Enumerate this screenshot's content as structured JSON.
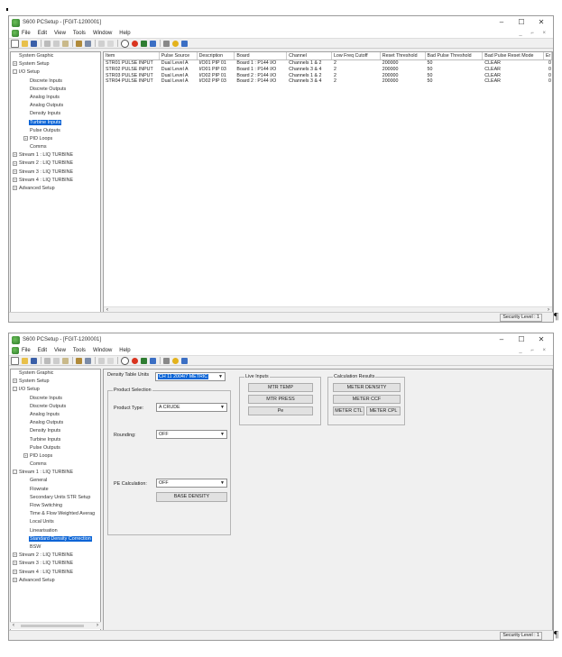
{
  "window1": {
    "title": "S600 PCSetup - [FGIT-1200001]",
    "menu": [
      "File",
      "Edit",
      "View",
      "Tools",
      "Window",
      "Help"
    ],
    "mdi_controls": "_ ⌐ ×",
    "tree": [
      {
        "label": "System Graphic",
        "level": 0,
        "expander": ""
      },
      {
        "label": "System Setup",
        "level": 0,
        "expander": "+"
      },
      {
        "label": "I/O Setup",
        "level": 0,
        "expander": "-"
      },
      {
        "label": "Discrete Inputs",
        "level": 1,
        "expander": ""
      },
      {
        "label": "Discrete Outputs",
        "level": 1,
        "expander": ""
      },
      {
        "label": "Analog Inputs",
        "level": 1,
        "expander": ""
      },
      {
        "label": "Analog Outputs",
        "level": 1,
        "expander": ""
      },
      {
        "label": "Density Inputs",
        "level": 1,
        "expander": ""
      },
      {
        "label": "Turbine Inputs",
        "level": 1,
        "expander": "",
        "selected": true
      },
      {
        "label": "Pulse Outputs",
        "level": 1,
        "expander": ""
      },
      {
        "label": "PID Loops",
        "level": 1,
        "expander": "+"
      },
      {
        "label": "Comms",
        "level": 1,
        "expander": ""
      },
      {
        "label": "Stream 1 : LIQ TURBINE",
        "level": 0,
        "expander": "+"
      },
      {
        "label": "Stream 2 : LIQ TURBINE",
        "level": 0,
        "expander": "+"
      },
      {
        "label": "Stream 3 : LIQ TURBINE",
        "level": 0,
        "expander": "+"
      },
      {
        "label": "Stream 4 : LIQ TURBINE",
        "level": 0,
        "expander": "+"
      },
      {
        "label": "Advanced Setup",
        "level": 0,
        "expander": "+"
      }
    ],
    "grid": {
      "columns": [
        "Item",
        "Pulse Source",
        "Description",
        "Board",
        "Channel",
        "Low Freq Cutoff",
        "Reset Threshold",
        "Bad Pulse Threshold",
        "Bad Pulse Reset Mode",
        "Er"
      ],
      "rows": [
        [
          "STR01 PULSE INPUT",
          "Dual Level A",
          "I/O01 PIP 01",
          "Board 1 : P144 I/O",
          "Channels 1 & 2",
          "2",
          "200000",
          "50",
          "CLEAR",
          "0"
        ],
        [
          "STR02 PULSE INPUT",
          "Dual Level A",
          "I/O01 PIP 03",
          "Board 1 : P144 I/O",
          "Channels 3 & 4",
          "2",
          "200000",
          "50",
          "CLEAR",
          "0"
        ],
        [
          "STR03 PULSE INPUT",
          "Dual Level A",
          "I/O02 PIP 01",
          "Board 2 : P144 I/O",
          "Channels 1 & 2",
          "2",
          "200000",
          "50",
          "CLEAR",
          "0"
        ],
        [
          "STR04 PULSE INPUT",
          "Dual Level A",
          "I/O02 PIP 03",
          "Board 2 : P144 I/O",
          "Channels 3 & 4",
          "2",
          "200000",
          "50",
          "CLEAR",
          "0"
        ]
      ]
    },
    "status": "Security Level : 1"
  },
  "window2": {
    "title": "S600 PCSetup - [FGIT-1200001]",
    "menu": [
      "File",
      "Edit",
      "View",
      "Tools",
      "Window",
      "Help"
    ],
    "mdi_controls": "_ ⌐ ×",
    "tree": [
      {
        "label": "System Graphic",
        "level": 0,
        "expander": ""
      },
      {
        "label": "System Setup",
        "level": 0,
        "expander": "+"
      },
      {
        "label": "I/O Setup",
        "level": 0,
        "expander": "-"
      },
      {
        "label": "Discrete Inputs",
        "level": 1,
        "expander": ""
      },
      {
        "label": "Discrete Outputs",
        "level": 1,
        "expander": ""
      },
      {
        "label": "Analog Inputs",
        "level": 1,
        "expander": ""
      },
      {
        "label": "Analog Outputs",
        "level": 1,
        "expander": ""
      },
      {
        "label": "Density Inputs",
        "level": 1,
        "expander": ""
      },
      {
        "label": "Turbine Inputs",
        "level": 1,
        "expander": ""
      },
      {
        "label": "Pulse Outputs",
        "level": 1,
        "expander": ""
      },
      {
        "label": "PID Loops",
        "level": 1,
        "expander": "+"
      },
      {
        "label": "Comms",
        "level": 1,
        "expander": ""
      },
      {
        "label": "Stream 1 : LIQ TURBINE",
        "level": 0,
        "expander": "-"
      },
      {
        "label": "General",
        "level": 1,
        "expander": ""
      },
      {
        "label": "Flowrate",
        "level": 1,
        "expander": ""
      },
      {
        "label": "Secondary Units STR Setup",
        "level": 1,
        "expander": ""
      },
      {
        "label": "Flow Switching",
        "level": 1,
        "expander": ""
      },
      {
        "label": "Time & Flow Weighted Averag",
        "level": 1,
        "expander": ""
      },
      {
        "label": "Local Units",
        "level": 1,
        "expander": ""
      },
      {
        "label": "Linearisation",
        "level": 1,
        "expander": ""
      },
      {
        "label": "Standard Density Correction",
        "level": 1,
        "expander": "",
        "selected": true
      },
      {
        "label": "BSW",
        "level": 1,
        "expander": ""
      },
      {
        "label": "Stream 2 : LIQ TURBINE",
        "level": 0,
        "expander": "+"
      },
      {
        "label": "Stream 3 : LIQ TURBINE",
        "level": 0,
        "expander": "+"
      },
      {
        "label": "Stream 4 : LIQ TURBINE",
        "level": 0,
        "expander": "+"
      },
      {
        "label": "Advanced Setup",
        "level": 0,
        "expander": "+"
      }
    ],
    "density_table_units_label": "Density Table Units",
    "density_table_units_value": "CH 11 2004/7 METRIC",
    "product_selection": {
      "title": "Product Selection",
      "product_type_label": "Product Type:",
      "product_type_value": "A CRUDE",
      "rounding_label": "Rounding:",
      "rounding_value": "OFF",
      "pe_calc_label": "PE Calculation:",
      "pe_calc_value": "OFF",
      "base_density_button": "BASE DENSITY"
    },
    "live_inputs": {
      "title": "Live Inputs",
      "buttons": [
        "MTR TEMP",
        "MTR PRESS",
        "Pe"
      ]
    },
    "calc_results": {
      "title": "Calculation Results",
      "meter_density": "METER DENSITY",
      "meter_ccf": "METER CCF",
      "meter_ctl": "METER CTL",
      "meter_cpl": "METER CPL"
    },
    "status": "Security Level : 1"
  },
  "pilcrow": "¶",
  "toolbar_icons": [
    "new-icon",
    "open-icon",
    "save-icon",
    "cut-icon",
    "copy-icon",
    "paste-icon",
    "connect-icon",
    "disconnect-icon",
    "compare-icon",
    "grid-icon",
    "refresh-icon",
    "stop-icon",
    "upload-icon",
    "download-icon",
    "print-icon",
    "help-icon",
    "pointer-help-icon"
  ]
}
